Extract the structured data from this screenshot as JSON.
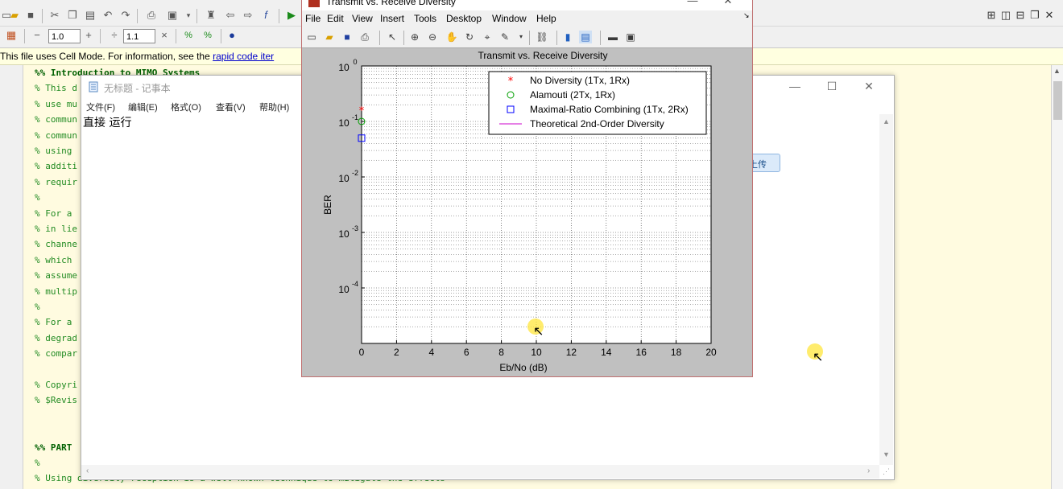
{
  "editor": {
    "zoom_minus": "−",
    "zoom_value_1": "1.0",
    "zoom_plus": "+",
    "zoom_div": "÷",
    "zoom_value_2": "1.1",
    "zoom_times": "×",
    "cell_mode_text": "This file uses Cell Mode. For information, see the ",
    "cell_mode_link": "rapid code iter",
    "code_lines": [
      "%% Introduction to MIMO Systems",
      "% This d",
      "% use mu",
      "% commun",
      "% commun",
      "% using ",
      "% additi",
      "% requir",
      "%",
      "% For a ",
      "% in lie",
      "% channe",
      "% which ",
      "% assume",
      "% multip",
      "%",
      "% For a ",
      "% degrad",
      "% compar",
      "",
      "% Copyri",
      "% $Revis",
      "",
      "",
      "%% PART",
      "%",
      "% Using diversity reception is a well-known technique to mitigate the effects"
    ]
  },
  "notepad": {
    "title": "无标题 - 记事本",
    "menu": [
      "文件(F)",
      "编辑(E)",
      "格式(O)",
      "查看(V)",
      "帮助(H)"
    ],
    "content": "直接 运行",
    "minimize": "—",
    "maximize": "☐",
    "close": "✕"
  },
  "upload_button": {
    "label": "拖拽上传"
  },
  "figure_window": {
    "title": "Transmit vs. Receive Diversity",
    "menu": [
      "File",
      "Edit",
      "View",
      "Insert",
      "Tools",
      "Desktop",
      "Window",
      "Help"
    ],
    "minimize": "—",
    "close": "✕"
  },
  "chart_data": {
    "type": "scatter",
    "title": "Transmit vs. Receive Diversity",
    "xlabel": "Eb/No (dB)",
    "ylabel": "BER",
    "xlim": [
      0,
      20
    ],
    "ylim_log10": [
      -5,
      0
    ],
    "y_scale": "log",
    "grid": "on",
    "minor_grid": "on",
    "x_ticks": [
      "0",
      "2",
      "4",
      "6",
      "8",
      "10",
      "12",
      "14",
      "16",
      "18",
      "20"
    ],
    "y_ticks": [
      {
        "base": "10",
        "exp": "0"
      },
      {
        "base": "10",
        "exp": "-1"
      },
      {
        "base": "10",
        "exp": "-2"
      },
      {
        "base": "10",
        "exp": "-3"
      },
      {
        "base": "10",
        "exp": "-4"
      }
    ],
    "legend_position": "top-right",
    "series": [
      {
        "name": "No Diversity (1Tx, 1Rx)",
        "marker": "*",
        "color": "#ff0000",
        "x": [
          0
        ],
        "y": [
          0.16
        ]
      },
      {
        "name": "Alamouti (2Tx, 1Rx)",
        "marker": "o",
        "color": "#00a000",
        "x": [
          0
        ],
        "y": [
          0.1
        ]
      },
      {
        "name": "Maximal-Ratio Combining (1Tx, 2Rx)",
        "marker": "s",
        "color": "#0000ff",
        "x": [
          0
        ],
        "y": [
          0.05
        ]
      },
      {
        "name": "Theoretical 2nd-Order Diversity",
        "marker": "line",
        "color": "#cc00cc",
        "x": [],
        "y": []
      }
    ]
  }
}
